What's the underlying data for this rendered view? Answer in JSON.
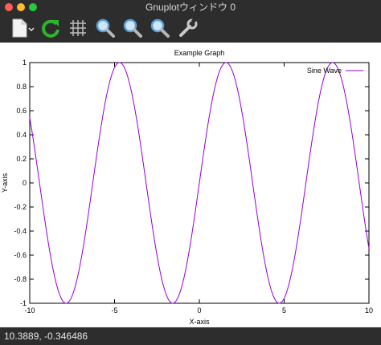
{
  "window": {
    "title": "Gnuplotウィンドウ 0"
  },
  "toolbar": {
    "tools": [
      {
        "name": "export-button",
        "icon": "document-icon"
      },
      {
        "name": "replot-button",
        "icon": "refresh-icon"
      },
      {
        "name": "grid-button",
        "icon": "grid-icon"
      },
      {
        "name": "zoom-previous-button",
        "icon": "zoom-icon"
      },
      {
        "name": "zoom-next-button",
        "icon": "zoom-icon"
      },
      {
        "name": "autoscale-button",
        "icon": "zoom-icon"
      },
      {
        "name": "settings-button",
        "icon": "wrench-icon"
      }
    ]
  },
  "status": {
    "coordinates": "10.3889, -0.346486"
  },
  "chart_data": {
    "type": "line",
    "title": "Example Graph",
    "xlabel": "X-axis",
    "ylabel": "Y-axis",
    "xlim": [
      -10,
      10
    ],
    "ylim": [
      -1,
      1
    ],
    "xticks": [
      "-10",
      "-5",
      "0",
      "5",
      "10"
    ],
    "yticks": [
      "-1",
      "-0.8",
      "-0.6",
      "-0.4",
      "-0.2",
      "0",
      "0.2",
      "0.4",
      "0.6",
      "0.8",
      "1"
    ],
    "series": [
      {
        "name": "Sine Wave",
        "function": "sin(x)",
        "color": "#9400d3"
      }
    ],
    "legend": "top-right",
    "grid": false
  }
}
